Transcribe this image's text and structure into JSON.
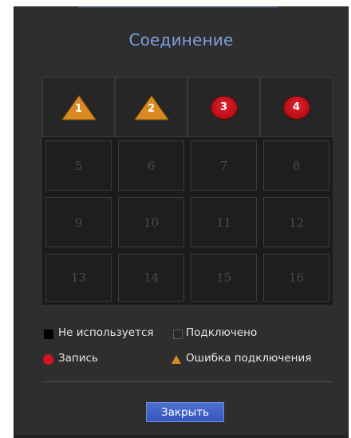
{
  "dialog": {
    "title": "Соединение",
    "close_label": "Закрыть"
  },
  "channels": [
    {
      "label": "1",
      "state": "connection-error"
    },
    {
      "label": "2",
      "state": "connection-error"
    },
    {
      "label": "3",
      "state": "recording"
    },
    {
      "label": "4",
      "state": "recording"
    },
    {
      "label": "5",
      "state": "unused"
    },
    {
      "label": "6",
      "state": "unused"
    },
    {
      "label": "7",
      "state": "unused"
    },
    {
      "label": "8",
      "state": "unused"
    },
    {
      "label": "9",
      "state": "unused"
    },
    {
      "label": "10",
      "state": "unused"
    },
    {
      "label": "11",
      "state": "unused"
    },
    {
      "label": "12",
      "state": "unused"
    },
    {
      "label": "13",
      "state": "unused"
    },
    {
      "label": "14",
      "state": "unused"
    },
    {
      "label": "15",
      "state": "unused"
    },
    {
      "label": "16",
      "state": "unused"
    }
  ],
  "legend": {
    "unused": "Не используется",
    "connected": "Подключено",
    "recording": "Запись",
    "error": "Ошибка подключения"
  },
  "colors": {
    "accent_title": "#7f9fe0",
    "error": "#d98a22",
    "recording": "#d4141c",
    "button": "#3f63c8"
  },
  "icons": {
    "error": "warning-triangle-icon",
    "recording": "red-circle-icon"
  }
}
